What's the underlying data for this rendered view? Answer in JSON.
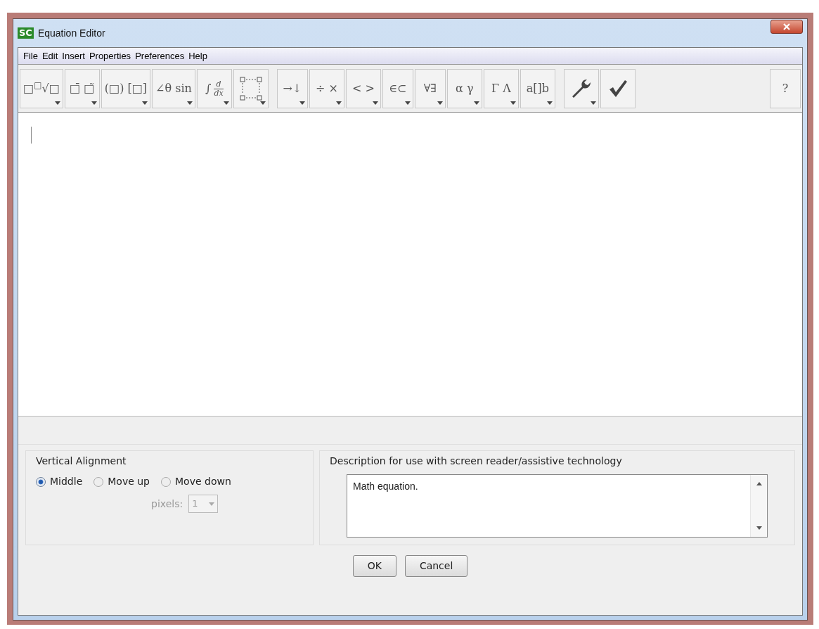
{
  "window": {
    "title": "Equation Editor",
    "app_icon": "SC"
  },
  "menu": [
    "File",
    "Edit",
    "Insert",
    "Properties",
    "Preferences",
    "Help"
  ],
  "toolbar": [
    {
      "kind": "text",
      "label": "□$^{□}$√□",
      "has_menu": true
    },
    {
      "kind": "text",
      "label": "□̄ □̃",
      "has_menu": true
    },
    {
      "kind": "text",
      "label": "(□) [□]",
      "has_menu": true
    },
    {
      "kind": "text",
      "label": "∠θ sin",
      "has_menu": true
    },
    {
      "kind": "fraction",
      "label": "∫",
      "numerator": "d",
      "denominator": "dx",
      "has_menu": true
    },
    {
      "kind": "matrix",
      "has_menu": true
    },
    {
      "kind": "text",
      "label": "→↓",
      "has_menu": true
    },
    {
      "kind": "text",
      "label": "÷ ×",
      "has_menu": true
    },
    {
      "kind": "text",
      "label": "< >",
      "has_menu": true
    },
    {
      "kind": "text",
      "label": "∈⊂",
      "has_menu": true
    },
    {
      "kind": "text",
      "label": "∀∃",
      "has_menu": true
    },
    {
      "kind": "text",
      "label": "α γ",
      "has_menu": true
    },
    {
      "kind": "text",
      "label": "Γ Λ",
      "has_menu": true
    },
    {
      "kind": "text",
      "label": "a[]b",
      "has_menu": true
    },
    {
      "kind": "wrench",
      "has_menu": true
    },
    {
      "kind": "check",
      "has_menu": false
    },
    {
      "kind": "text",
      "label": "?",
      "has_menu": false
    }
  ],
  "vertical_alignment": {
    "title": "Vertical Alignment",
    "options": [
      {
        "label": "Middle",
        "selected": true
      },
      {
        "label": "Move up",
        "selected": false
      },
      {
        "label": "Move down",
        "selected": false
      }
    ],
    "pixels_label": "pixels:",
    "pixels_value": "1",
    "pixels_disabled": true
  },
  "description": {
    "title": "Description for use with screen reader/assistive technology",
    "value": "Math equation."
  },
  "buttons": [
    "OK",
    "Cancel"
  ]
}
